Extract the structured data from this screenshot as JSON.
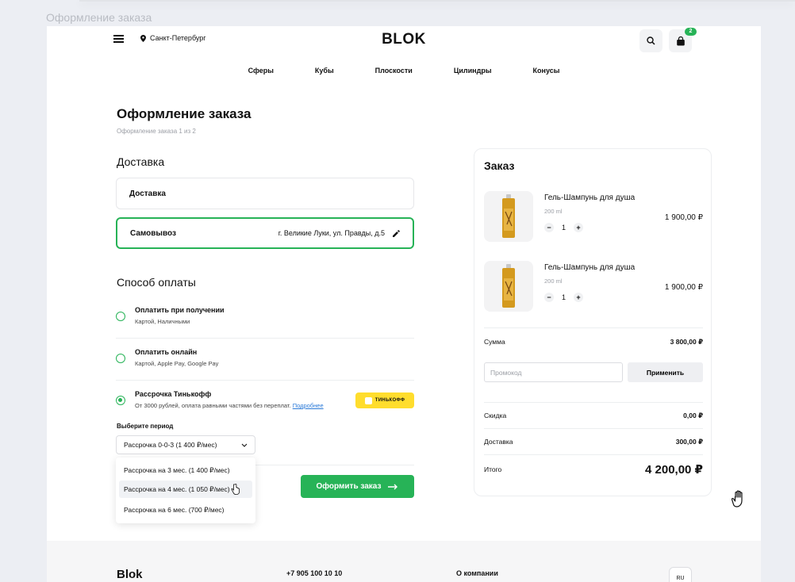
{
  "page_caption": "Оформление заказа",
  "header": {
    "city": "Санкт-Петербург",
    "logo": "BLOK",
    "cart_count": "2"
  },
  "nav": [
    "Сферы",
    "Кубы",
    "Плоскости",
    "Цилиндры",
    "Конусы"
  ],
  "checkout": {
    "title": "Оформление заказа",
    "step": "Оформление заказа 1 из 2",
    "delivery_heading": "Доставка",
    "delivery_options": [
      {
        "label": "Доставка"
      },
      {
        "label": "Самовывоз",
        "address": "г. Великие Луки, ул. Правды, д.5"
      }
    ],
    "payment_heading": "Способ оплаты",
    "payment_options": [
      {
        "title": "Оплатить при получении",
        "sub": "Картой, Наличными"
      },
      {
        "title": "Оплатить онлайн",
        "sub": "Картой, Apple Pay, Google Pay"
      },
      {
        "title": "Рассрочка Тинькофф",
        "sub": "От 3000 рублей, оплата равными частями без переплат.",
        "link": "Подробнее"
      }
    ],
    "tinkoff_label": "ТИНЬКОФФ",
    "period_label": "Выберите период",
    "period_selected": "Рассрочка 0-0-3 (1 400 ₽/мес)",
    "period_options": [
      "Рассрочка на 3 мес. (1 400 ₽/мес)",
      "Рассрочка на 4 мес. (1 050 ₽/мес)",
      "Рассрочка на 6 мес. (700 ₽/мес)"
    ],
    "submit_label": "Оформить заказ"
  },
  "order": {
    "title": "Заказ",
    "items": [
      {
        "name": "Гель-Шампунь для душа",
        "volume": "200 ml",
        "qty": "1",
        "price": "1 900,00 ₽"
      },
      {
        "name": "Гель-Шампунь для душа",
        "volume": "200 ml",
        "qty": "1",
        "price": "1 900,00 ₽"
      }
    ],
    "sum_label": "Сумма",
    "sum_value": "3 800,00 ₽",
    "promo_placeholder": "Промокод",
    "apply_label": "Применить",
    "discount_label": "Скидка",
    "discount_value": "0,00 ₽",
    "delivery_label": "Доставка",
    "delivery_value": "300,00 ₽",
    "total_label": "Итого",
    "total_value": "4 200,00 ₽"
  },
  "footer": {
    "logo": "Blok",
    "phone": "+7 905 100 10 10",
    "about": "О компании",
    "lang": "RU"
  },
  "colors": {
    "accent": "#27b357",
    "tinkoff": "#ffdd2d",
    "link": "#2b7ad8"
  }
}
